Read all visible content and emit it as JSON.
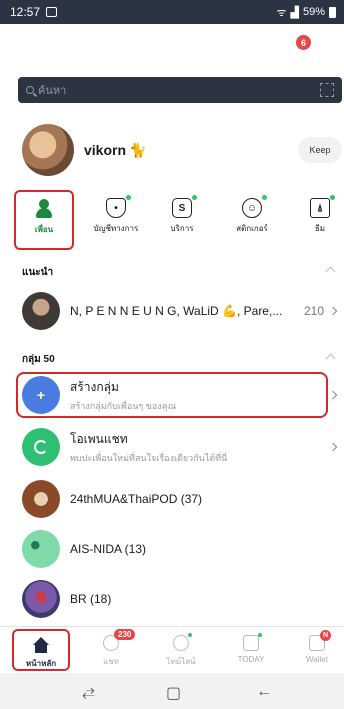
{
  "status": {
    "time": "12:57",
    "battery": "59%"
  },
  "top_badge": "6",
  "search": {
    "placeholder": "ค้นหา"
  },
  "profile": {
    "name": "vikorn",
    "keep_label": "Keep"
  },
  "tabs": [
    {
      "label": "เพื่อน",
      "icon": "person-icon",
      "active": true
    },
    {
      "label": "บัญชีทางการ",
      "icon": "shield-icon"
    },
    {
      "label": "บริการ",
      "icon": "service-icon"
    },
    {
      "label": "สติกเกอร์",
      "icon": "smiley-icon"
    },
    {
      "label": "ธีม",
      "icon": "brush-icon"
    }
  ],
  "recommended": {
    "header": "แนะนำ",
    "row_text": "N, P E N N E U N G, WaLiD 💪, Pare,...",
    "count": "210"
  },
  "groups": {
    "header": "กลุ่ม 50",
    "create": {
      "title": "สร้างกลุ่ม",
      "subtitle": "สร้างกลุ่มกับเพื่อนๆ ของคุณ"
    },
    "openchat": {
      "title": "โอเพนแชท",
      "subtitle": "พบปะเพื่อนใหม่ที่สนใจเรื่องเดียวกันได้ที่นี่"
    },
    "items": [
      {
        "name": "24thMUA&ThaiPOD (37)"
      },
      {
        "name": "AIS-NIDA (13)"
      },
      {
        "name": "BR (18)"
      }
    ]
  },
  "bottom_nav": [
    {
      "label": "หน้าหลัก",
      "active": true
    },
    {
      "label": "แชท",
      "badge": "230"
    },
    {
      "label": "ไทม์ไลน์"
    },
    {
      "label": "TODAY"
    },
    {
      "label": "Wallet",
      "badge": "N"
    }
  ],
  "colors": {
    "accent_green": "#1c8a3d",
    "search_bg": "#2c3441",
    "highlight_red": "#d22a2a"
  }
}
